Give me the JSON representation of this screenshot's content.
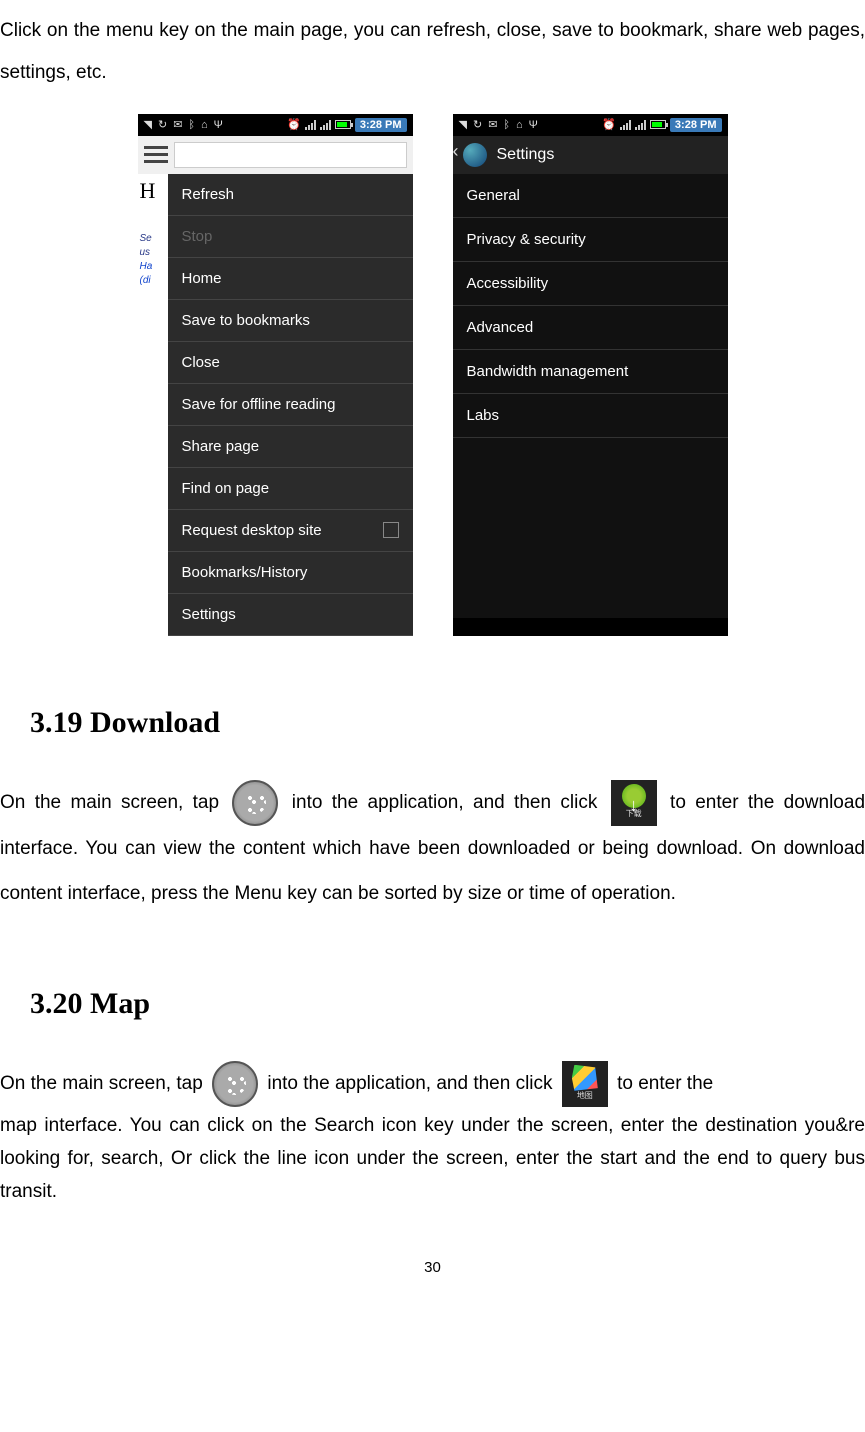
{
  "intro": "Click on the menu key on the main page, you can refresh, close, save to bookmark, share web pages, settings, etc.",
  "status": {
    "time": "3:28 PM"
  },
  "browser_menu": {
    "bg_letter": "H",
    "bg_text_1": "Se",
    "bg_text_2": "us",
    "bg_text_3": "Ha",
    "bg_text_4": "(di",
    "items": [
      {
        "label": "Refresh",
        "disabled": false
      },
      {
        "label": "Stop",
        "disabled": true
      },
      {
        "label": "Home",
        "disabled": false
      },
      {
        "label": "Save to bookmarks",
        "disabled": false
      },
      {
        "label": "Close",
        "disabled": false
      },
      {
        "label": "Save for offline reading",
        "disabled": false
      },
      {
        "label": "Share page",
        "disabled": false
      },
      {
        "label": "Find on page",
        "disabled": false
      },
      {
        "label": "Request desktop site",
        "disabled": false,
        "checkbox": true
      },
      {
        "label": "Bookmarks/History",
        "disabled": false
      },
      {
        "label": "Settings",
        "disabled": false
      }
    ]
  },
  "settings_screen": {
    "title": "Settings",
    "items": [
      "General",
      "Privacy & security",
      "Accessibility",
      "Advanced",
      "Bandwidth management",
      "Labs"
    ]
  },
  "sections": {
    "download": {
      "heading": "3.19 Download",
      "p1_a": "On the main screen, tap ",
      "p1_b": " into the application, and then click ",
      "p1_c": " to enter the download interface. You can view the content which have been downloaded or being download. On download content interface, press the Menu key can be sorted by size or time of operation.",
      "icon_label": "下载"
    },
    "map": {
      "heading": "3.20 Map",
      "p1_a": "On the main screen, tap ",
      "p1_b": " into the application, and then click ",
      "p1_c": " to enter the ",
      "p2": "map interface. You can click on the Search icon key under the screen, enter the destination you&re looking for, search, Or click the line icon under the screen, enter the start and the end to query bus transit.",
      "icon_label": "地图"
    }
  },
  "page_number": "30"
}
